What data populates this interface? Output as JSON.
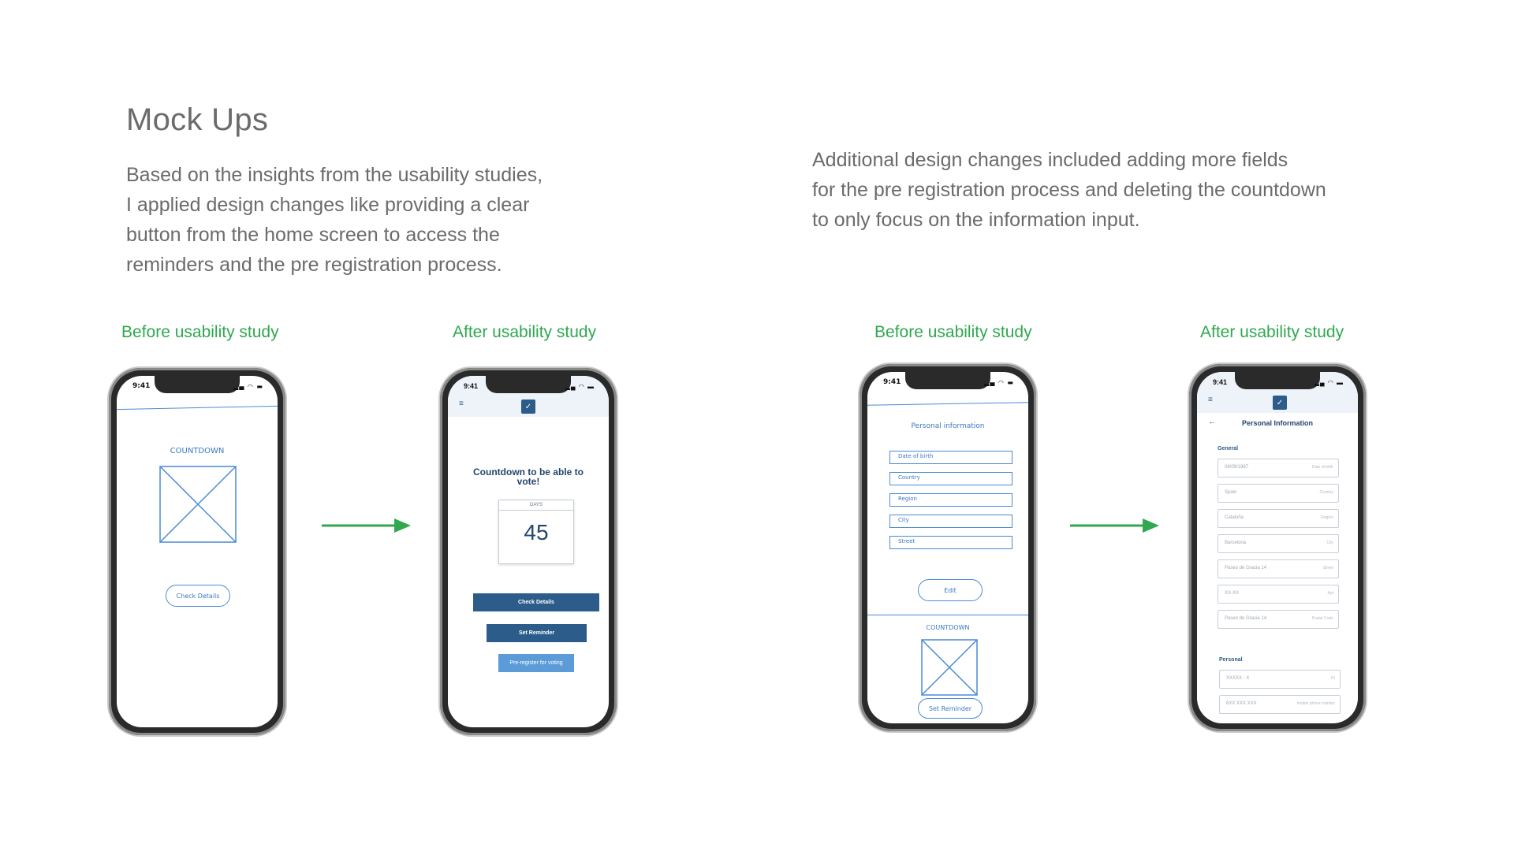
{
  "heading": "Mock Ups",
  "paragraph_left": "Based on the insights from the usability studies,\nI applied design changes like providing a clear\nbutton from the home screen to access the\nreminders and the pre registration process.",
  "paragraph_right": "Additional design changes included adding more fields\nfor the pre registration process and deleting the countdown\nto only focus on the information input.",
  "labels": {
    "before_1": "Before usability study",
    "after_1": "After usability study",
    "before_2": "Before usability study",
    "after_2": "After usability study"
  },
  "status_time": "9:41",
  "phone1": {
    "title": "COUNTDOWN",
    "button": "Check Details"
  },
  "phone2": {
    "title": "Countdown to be able to vote!",
    "days_label": "DAYS",
    "days_value": "45",
    "btn_check": "Check Details",
    "btn_reminder": "Set Reminder",
    "btn_prereg": "Pre-register for voting"
  },
  "phone3": {
    "title": "Personal information",
    "fields": [
      "Date of birth",
      "Country",
      "Region",
      "City",
      "Street"
    ],
    "edit": "Edit",
    "countdown": "COUNTDOWN",
    "reminder": "Set Reminder"
  },
  "phone4": {
    "title": "Personal Information",
    "section_general": "General",
    "section_personal": "Personal",
    "fields": [
      {
        "value": "09/09/1987",
        "hint": "Date of birth"
      },
      {
        "value": "Spain",
        "hint": "Country"
      },
      {
        "value": "Cataluña",
        "hint": "Region"
      },
      {
        "value": "Barcelona",
        "hint": "City"
      },
      {
        "value": "Paseo de Gracia 14",
        "hint": "Street"
      },
      {
        "value": "XX-XX",
        "hint": "Apt"
      },
      {
        "value": "Paseo de Gracia 14",
        "hint": "Postal Code"
      }
    ],
    "personal_fields": [
      {
        "value": "XXXXX - X",
        "hint": "ID"
      },
      {
        "value": "8XX XXX XXX",
        "hint": "mobile phone number"
      }
    ]
  },
  "colors": {
    "green": "#2fa84f",
    "navy": "#2b5c8a",
    "light_blue": "#5a9bd8",
    "sketch_blue": "#4a8ad4"
  },
  "icons": [
    "arrow-right-icon",
    "menu-icon",
    "check-badge-icon",
    "back-arrow-icon",
    "signal-wifi-battery-icon"
  ]
}
